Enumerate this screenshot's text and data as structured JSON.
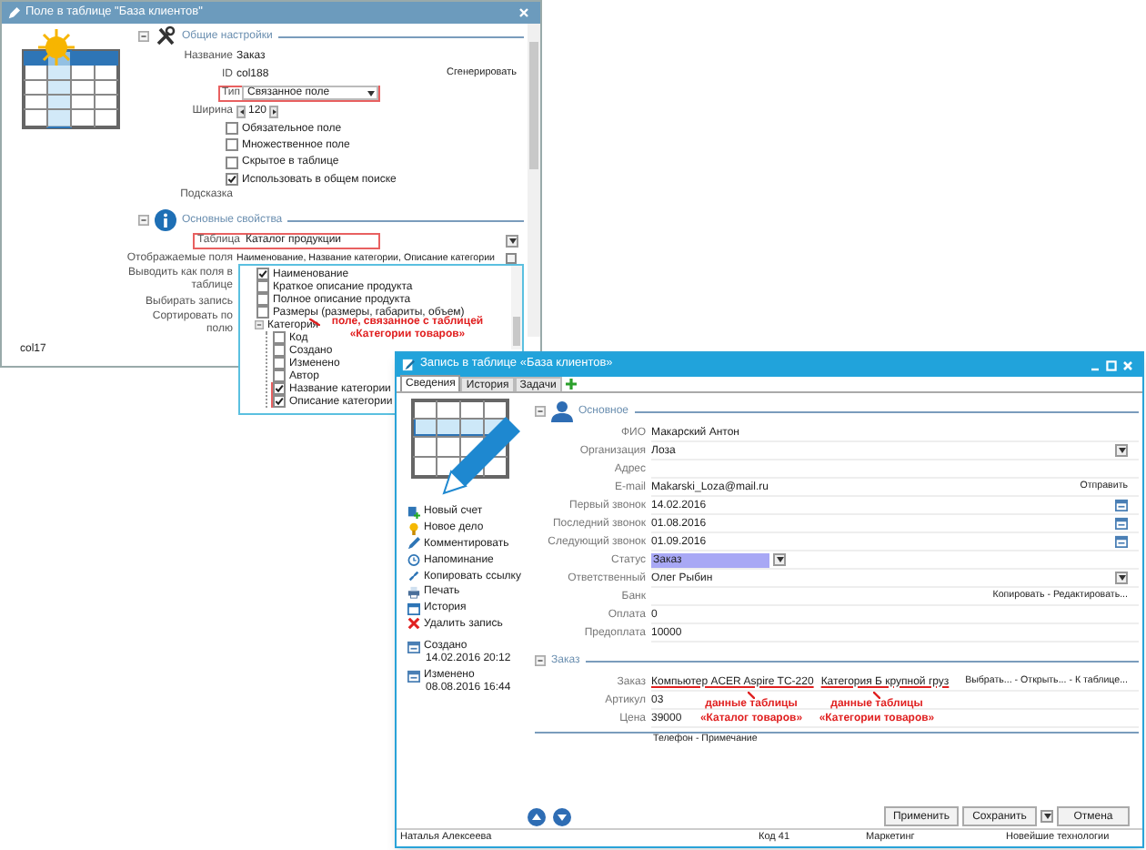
{
  "field_window": {
    "title": "Поле в таблице \"База клиентов\"",
    "general": {
      "title": "Общие настройки",
      "rows": [
        {
          "kind": "text",
          "label": "Название",
          "value": "Заказ"
        },
        {
          "kind": "id",
          "label": "ID",
          "value": "col188",
          "action": "Сгенерировать"
        },
        {
          "kind": "select-short",
          "label": "Тип",
          "value": "Связанное поле",
          "highlighted": true
        },
        {
          "kind": "spinner",
          "label": "Ширина",
          "value": "120"
        },
        {
          "kind": "check",
          "label": "Обязательное поле",
          "checked": false
        },
        {
          "kind": "check",
          "label": "Множественное поле",
          "checked": false
        },
        {
          "kind": "check",
          "label": "Скрытое в таблице",
          "checked": false
        },
        {
          "kind": "check",
          "label": "Использовать в общем поиске",
          "checked": true
        },
        {
          "kind": "label",
          "label": "Подсказка"
        }
      ]
    },
    "main": {
      "title": "Основные свойства",
      "rows": [
        {
          "kind": "select",
          "label": "Таблица",
          "value": "Каталог продукции",
          "highlighted": true
        },
        {
          "kind": "fields",
          "label": "Отображаемые поля",
          "value": "Наименование, Название категории, Описание категории"
        },
        {
          "kind": "label",
          "label": "Выводить как поля в таблице"
        },
        {
          "kind": "label",
          "label": "Выбирать запись"
        },
        {
          "kind": "label",
          "label": "Сортировать по полю"
        }
      ]
    },
    "footer_id": "col17",
    "tree": {
      "note": "поле, связанное с таблицей «Категории товаров»",
      "items": [
        {
          "label": "Наименование",
          "checked": true,
          "highlighted": false
        },
        {
          "label": "Краткое описание продукта",
          "checked": false,
          "highlighted": false
        },
        {
          "label": "Полное описание продукта",
          "checked": false,
          "highlighted": false
        },
        {
          "label": "Размеры (размеры, габариты, объем)",
          "checked": false,
          "highlighted": false
        },
        {
          "label": "Категория",
          "expanded": true,
          "children": [
            {
              "label": "Код",
              "checked": false,
              "highlighted": false
            },
            {
              "label": "Создано",
              "checked": false,
              "highlighted": false
            },
            {
              "label": "Изменено",
              "checked": false,
              "highlighted": false
            },
            {
              "label": "Автор",
              "checked": false,
              "highlighted": false
            },
            {
              "label": "Название категории",
              "checked": true,
              "highlighted": true
            },
            {
              "label": "Описание категории",
              "checked": true,
              "highlighted": true
            }
          ]
        }
      ]
    }
  },
  "record_window": {
    "title": "Запись в таблице «База клиентов»",
    "tabs": [
      {
        "label": "Сведения",
        "selected": true
      },
      {
        "label": "История",
        "selected": false
      },
      {
        "label": "Задачи",
        "selected": false
      }
    ],
    "actions": [
      {
        "kind": "invoice",
        "label": "Новый счет"
      },
      {
        "kind": "task",
        "label": "Новое дело"
      },
      {
        "kind": "comment",
        "label": "Комментировать"
      },
      {
        "kind": "reminder",
        "label": "Напоминание"
      },
      {
        "kind": "link",
        "label": "Копировать ссылку"
      },
      {
        "kind": "print",
        "label": "Печать"
      },
      {
        "kind": "history",
        "label": "История"
      },
      {
        "kind": "delete",
        "label": "Удалить запись"
      }
    ],
    "created": {
      "label": "Создано",
      "value": "14.02.2016 20:12"
    },
    "modified": {
      "label": "Изменено",
      "value": "08.08.2016 16:44"
    },
    "main_section": "Основное",
    "fields": [
      {
        "kind": "text",
        "label": "ФИО",
        "value": "Макарский Антон"
      },
      {
        "kind": "select",
        "label": "Организация",
        "value": "Лоза"
      },
      {
        "kind": "text",
        "label": "Адрес"
      },
      {
        "kind": "text",
        "label": "E-mail",
        "value": "Makarski_Loza@mail.ru",
        "action": "Отправить"
      },
      {
        "kind": "date",
        "label": "Первый звонок",
        "value": "14.02.2016"
      },
      {
        "kind": "date",
        "label": "Последний звонок",
        "value": "01.08.2016"
      },
      {
        "kind": "date",
        "label": "Следующий звонок",
        "value": "01.09.2016"
      },
      {
        "kind": "status",
        "label": "Статус",
        "value": "Заказ"
      },
      {
        "kind": "select",
        "label": "Ответственный",
        "value": "Олег Рыбин"
      },
      {
        "kind": "text",
        "label": "Банк",
        "action": "Копировать - Редактировать..."
      },
      {
        "kind": "text",
        "label": "Оплата",
        "value": "0"
      },
      {
        "kind": "text",
        "label": "Предоплата",
        "value": "10000"
      }
    ],
    "order_section": "Заказ",
    "order_fields": [
      {
        "kind": "links",
        "label": "Заказ",
        "links": [
          "Компьютер  ACER Aspire TC-220",
          "Категория Б крупной груз"
        ],
        "action": "Выбрать... - Открыть... - К таблице..."
      },
      {
        "kind": "text",
        "label": "Артикул",
        "value": "03"
      },
      {
        "kind": "text",
        "label": "Цена",
        "value": "39000"
      }
    ],
    "notes": [
      "данные таблицы «Каталог товаров»",
      "данные таблицы «Категории товаров»"
    ],
    "extra_links": "Телефон - Примечание",
    "buttons": [
      "Применить",
      "Сохранить",
      "Отмена"
    ],
    "status_bar": [
      "Наталья Алексеева",
      "Код 41",
      "Маркетинг",
      "Новейшие технологии"
    ]
  }
}
